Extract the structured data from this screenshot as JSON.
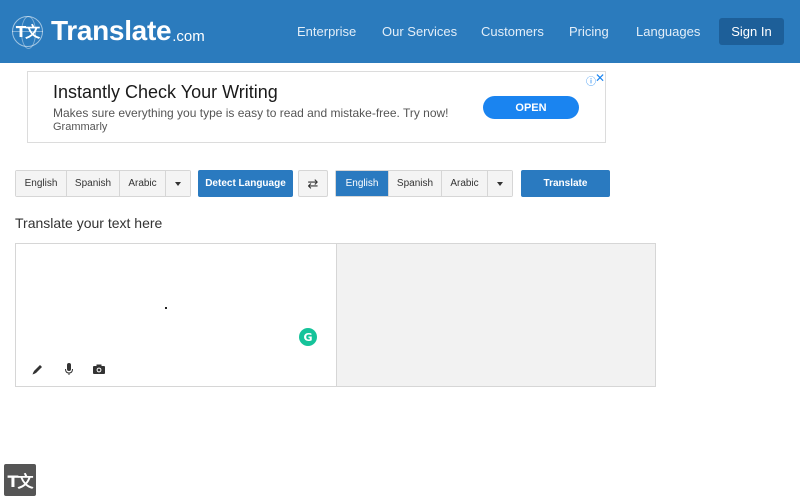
{
  "header": {
    "logo_glyph": "T文",
    "logo_text": "Translate",
    "logo_tld": ".com",
    "nav": [
      {
        "label": "Enterprise"
      },
      {
        "label": "Our Services"
      },
      {
        "label": "Customers"
      },
      {
        "label": "Pricing"
      },
      {
        "label": "Languages"
      }
    ],
    "signin_label": "Sign In"
  },
  "ad": {
    "title": "Instantly Check Your Writing",
    "description": "Makes sure everything you type is easy to read and mistake-free. Try now!",
    "brand": "Grammarly",
    "cta": "OPEN",
    "info_icon": "ⓘ",
    "close_icon": "✕"
  },
  "toolbar": {
    "source_langs": [
      "English",
      "Spanish",
      "Arabic"
    ],
    "detect_label": "Detect Language",
    "swap_icon": "⇄",
    "target_langs": [
      "English",
      "Spanish",
      "Arabic"
    ],
    "translate_label": "Translate"
  },
  "main": {
    "section_title": "Translate your text here",
    "grammarly_glyph": "G"
  },
  "footer": {
    "corner_logo_glyph": "T文"
  },
  "colors": {
    "header_bg": "#2b7bbd",
    "primary": "#2a7ac0",
    "ad_cta": "#1a84f0",
    "grammarly": "#15c39a"
  }
}
